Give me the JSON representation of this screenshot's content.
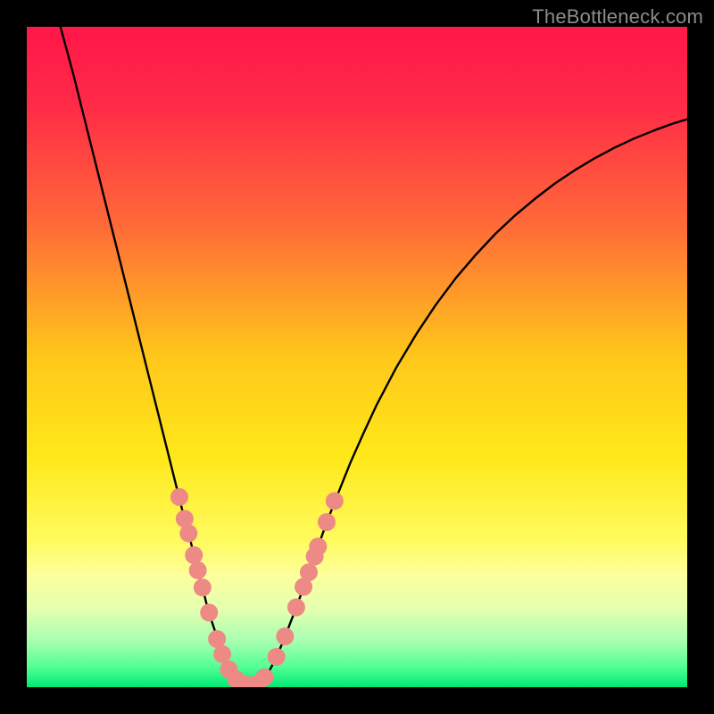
{
  "watermark": "TheBottleneck.com",
  "chart_data": {
    "type": "line",
    "title": "",
    "xlabel": "",
    "ylabel": "",
    "xlim": [
      0,
      1
    ],
    "ylim": [
      0,
      1
    ],
    "gradient_stops": [
      {
        "offset": 0.0,
        "color": "#ff1749"
      },
      {
        "offset": 0.12,
        "color": "#ff2b47"
      },
      {
        "offset": 0.3,
        "color": "#ff6a38"
      },
      {
        "offset": 0.5,
        "color": "#ffc71a"
      },
      {
        "offset": 0.65,
        "color": "#ffe81a"
      },
      {
        "offset": 0.78,
        "color": "#fffb60"
      },
      {
        "offset": 0.83,
        "color": "#fdff9c"
      },
      {
        "offset": 0.88,
        "color": "#e6ffb0"
      },
      {
        "offset": 0.93,
        "color": "#a8ffb0"
      },
      {
        "offset": 0.97,
        "color": "#51ff93"
      },
      {
        "offset": 1.0,
        "color": "#00e876"
      }
    ],
    "series": [
      {
        "name": "curve",
        "type": "line",
        "stroke": "#000000",
        "stroke_width": 2.4,
        "points": [
          {
            "x": 0.051,
            "y": 1.0
          },
          {
            "x": 0.07,
            "y": 0.93
          },
          {
            "x": 0.09,
            "y": 0.85
          },
          {
            "x": 0.11,
            "y": 0.77
          },
          {
            "x": 0.13,
            "y": 0.69
          },
          {
            "x": 0.15,
            "y": 0.61
          },
          {
            "x": 0.17,
            "y": 0.53
          },
          {
            "x": 0.19,
            "y": 0.45
          },
          {
            "x": 0.2,
            "y": 0.41
          },
          {
            "x": 0.21,
            "y": 0.37
          },
          {
            "x": 0.22,
            "y": 0.33
          },
          {
            "x": 0.23,
            "y": 0.29
          },
          {
            "x": 0.235,
            "y": 0.27
          },
          {
            "x": 0.24,
            "y": 0.252
          },
          {
            "x": 0.245,
            "y": 0.233
          },
          {
            "x": 0.25,
            "y": 0.213
          },
          {
            "x": 0.255,
            "y": 0.193
          },
          {
            "x": 0.26,
            "y": 0.174
          },
          {
            "x": 0.265,
            "y": 0.154
          },
          {
            "x": 0.27,
            "y": 0.135
          },
          {
            "x": 0.275,
            "y": 0.115
          },
          {
            "x": 0.28,
            "y": 0.1
          },
          {
            "x": 0.285,
            "y": 0.085
          },
          {
            "x": 0.29,
            "y": 0.068
          },
          {
            "x": 0.295,
            "y": 0.053
          },
          {
            "x": 0.3,
            "y": 0.04
          },
          {
            "x": 0.305,
            "y": 0.03
          },
          {
            "x": 0.31,
            "y": 0.022
          },
          {
            "x": 0.315,
            "y": 0.016
          },
          {
            "x": 0.32,
            "y": 0.011
          },
          {
            "x": 0.325,
            "y": 0.007
          },
          {
            "x": 0.33,
            "y": 0.005
          },
          {
            "x": 0.335,
            "y": 0.004
          },
          {
            "x": 0.34,
            "y": 0.003
          },
          {
            "x": 0.345,
            "y": 0.004
          },
          {
            "x": 0.35,
            "y": 0.006
          },
          {
            "x": 0.355,
            "y": 0.01
          },
          {
            "x": 0.36,
            "y": 0.015
          },
          {
            "x": 0.365,
            "y": 0.021
          },
          {
            "x": 0.37,
            "y": 0.03
          },
          {
            "x": 0.377,
            "y": 0.044
          },
          {
            "x": 0.385,
            "y": 0.062
          },
          {
            "x": 0.395,
            "y": 0.087
          },
          {
            "x": 0.405,
            "y": 0.113
          },
          {
            "x": 0.415,
            "y": 0.14
          },
          {
            "x": 0.425,
            "y": 0.168
          },
          {
            "x": 0.435,
            "y": 0.196
          },
          {
            "x": 0.445,
            "y": 0.224
          },
          {
            "x": 0.455,
            "y": 0.252
          },
          {
            "x": 0.47,
            "y": 0.29
          },
          {
            "x": 0.49,
            "y": 0.34
          },
          {
            "x": 0.51,
            "y": 0.385
          },
          {
            "x": 0.53,
            "y": 0.428
          },
          {
            "x": 0.56,
            "y": 0.485
          },
          {
            "x": 0.59,
            "y": 0.535
          },
          {
            "x": 0.62,
            "y": 0.58
          },
          {
            "x": 0.65,
            "y": 0.62
          },
          {
            "x": 0.68,
            "y": 0.655
          },
          {
            "x": 0.71,
            "y": 0.687
          },
          {
            "x": 0.74,
            "y": 0.715
          },
          {
            "x": 0.77,
            "y": 0.74
          },
          {
            "x": 0.8,
            "y": 0.763
          },
          {
            "x": 0.83,
            "y": 0.783
          },
          {
            "x": 0.86,
            "y": 0.801
          },
          {
            "x": 0.89,
            "y": 0.817
          },
          {
            "x": 0.92,
            "y": 0.831
          },
          {
            "x": 0.95,
            "y": 0.843
          },
          {
            "x": 0.98,
            "y": 0.854
          },
          {
            "x": 1.0,
            "y": 0.86
          }
        ]
      },
      {
        "name": "dots",
        "type": "scatter",
        "fill": "#ed8a86",
        "radius": 10,
        "points": [
          {
            "x": 0.231,
            "y": 0.288
          },
          {
            "x": 0.239,
            "y": 0.255
          },
          {
            "x": 0.245,
            "y": 0.233
          },
          {
            "x": 0.253,
            "y": 0.2
          },
          {
            "x": 0.259,
            "y": 0.177
          },
          {
            "x": 0.266,
            "y": 0.151
          },
          {
            "x": 0.276,
            "y": 0.113
          },
          {
            "x": 0.288,
            "y": 0.073
          },
          {
            "x": 0.296,
            "y": 0.05
          },
          {
            "x": 0.306,
            "y": 0.027
          },
          {
            "x": 0.317,
            "y": 0.012
          },
          {
            "x": 0.328,
            "y": 0.005
          },
          {
            "x": 0.338,
            "y": 0.003
          },
          {
            "x": 0.349,
            "y": 0.005
          },
          {
            "x": 0.36,
            "y": 0.015
          },
          {
            "x": 0.378,
            "y": 0.046
          },
          {
            "x": 0.391,
            "y": 0.077
          },
          {
            "x": 0.408,
            "y": 0.121
          },
          {
            "x": 0.419,
            "y": 0.152
          },
          {
            "x": 0.427,
            "y": 0.174
          },
          {
            "x": 0.436,
            "y": 0.198
          },
          {
            "x": 0.441,
            "y": 0.213
          },
          {
            "x": 0.454,
            "y": 0.25
          },
          {
            "x": 0.466,
            "y": 0.282
          }
        ]
      }
    ]
  }
}
